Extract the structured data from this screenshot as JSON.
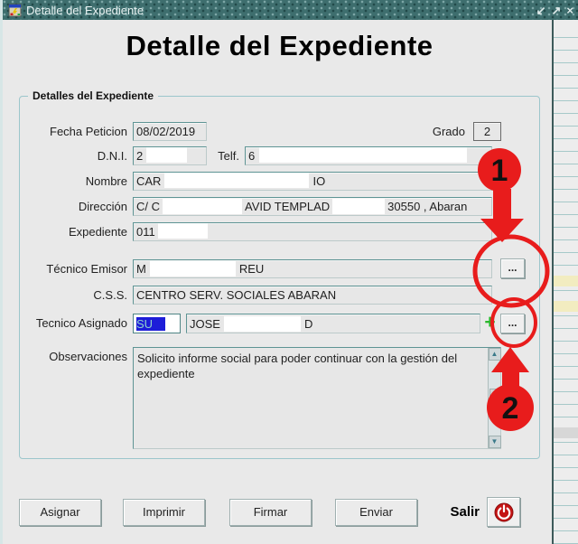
{
  "window": {
    "title": "Detalle del Expediente",
    "controls": {
      "minimize": "↙",
      "restore": "↗",
      "close": "×"
    }
  },
  "heading": "Detalle del Expediente",
  "group_title": "Detalles del Expediente",
  "fields": {
    "fecha_peticion": {
      "label": "Fecha Peticion",
      "value": "08/02/2019"
    },
    "grado": {
      "label": "Grado",
      "value": "2"
    },
    "dni": {
      "label": "D.N.I.",
      "value": "2"
    },
    "telf": {
      "label": "Telf.",
      "value": "6"
    },
    "nombre": {
      "label": "Nombre",
      "seg1": "CAR",
      "seg2": "IO"
    },
    "direccion": {
      "label": "Dirección",
      "seg1": "C/ C",
      "seg2": "AVID TEMPLAD",
      "seg3": "30550 , Abaran"
    },
    "expediente": {
      "label": "Expediente",
      "value": "011"
    },
    "tecnico_emisor": {
      "label": "Técnico Emisor",
      "seg1": "M",
      "seg2": "REU",
      "browse": "..."
    },
    "css": {
      "label": "C.S.S.",
      "value": "CENTRO SERV. SOCIALES ABARAN"
    },
    "tecnico_asignado": {
      "label": "Tecnico Asignado",
      "code": "SU",
      "seg1": "JOSE",
      "seg2": "D",
      "add": "+",
      "browse": "..."
    },
    "observaciones": {
      "label": "Observaciones",
      "value": "Solicito informe social para poder continuar con la gestión del expediente"
    }
  },
  "scrollbar": {
    "up": "▲",
    "down": "▼"
  },
  "buttons": {
    "asignar": "Asignar",
    "imprimir": "Imprimir",
    "firmar": "Firmar",
    "enviar": "Enviar"
  },
  "salir_label": "Salir",
  "annotations": {
    "step1": "1",
    "step2": "2"
  },
  "colors": {
    "titlebar": "#3e6e6e",
    "window_bg": "#e9e9e9",
    "field_border": "#6fa3a3",
    "group_border": "#9cc6cb",
    "annotation_red": "#e81c1c",
    "selection_blue": "#1d1dd8",
    "plus_green": "#2db52d",
    "power_red": "#cc1414"
  }
}
